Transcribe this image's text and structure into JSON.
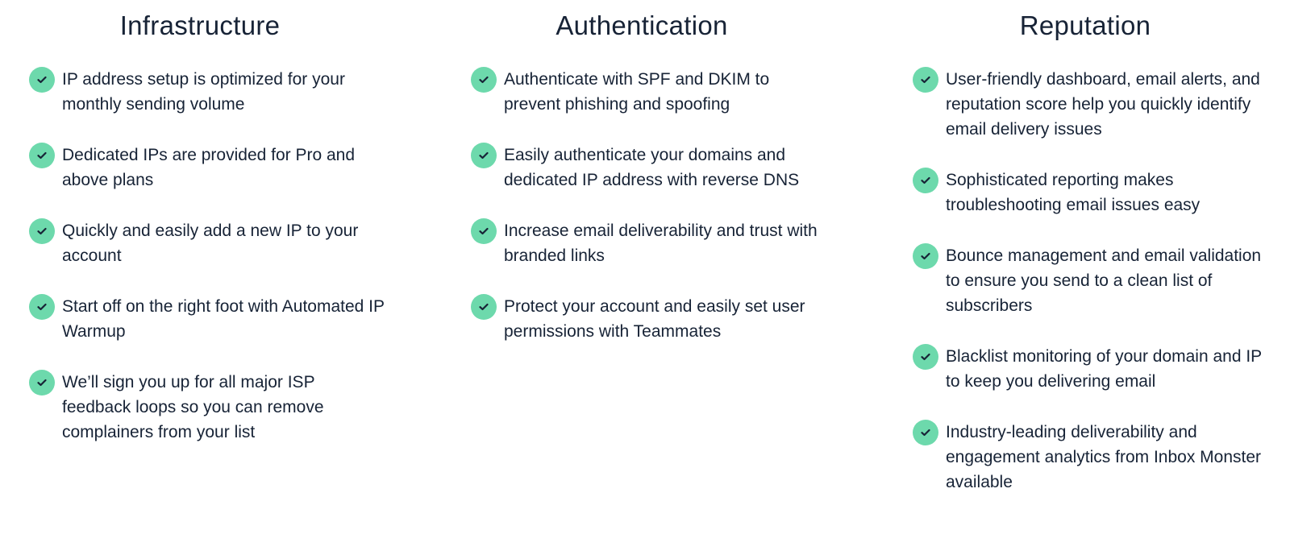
{
  "accent_color": "#6dd9ac",
  "text_color": "#172336",
  "icon": "check-circle-icon",
  "columns": [
    {
      "heading": "Infrastructure",
      "items": [
        "IP address setup is optimized for your monthly sending volume",
        "Dedicated IPs are provided for Pro and above plans",
        "Quickly and easily add a new IP to your account",
        "Start off on the right foot with Automated IP Warmup",
        "We’ll sign you up for all major ISP feedback loops so you can remove complainers from your list"
      ]
    },
    {
      "heading": "Authentication",
      "items": [
        "Authenticate with SPF and DKIM to prevent phishing and spoofing",
        "Easily authenticate your domains and dedicated IP address with reverse DNS",
        "Increase email deliverability and trust with branded links",
        "Protect your account and easily set user permissions with Teammates"
      ]
    },
    {
      "heading": "Reputation",
      "items": [
        "User-friendly dashboard, email alerts, and reputation score help you quickly identify email delivery issues",
        "Sophisticated reporting makes troubleshooting email issues easy",
        "Bounce management and email validation to ensure you send to a clean list of subscribers",
        "Blacklist monitoring of your domain and IP to keep you delivering email",
        "Industry-leading deliverability and engagement analytics from Inbox Monster available"
      ]
    }
  ]
}
